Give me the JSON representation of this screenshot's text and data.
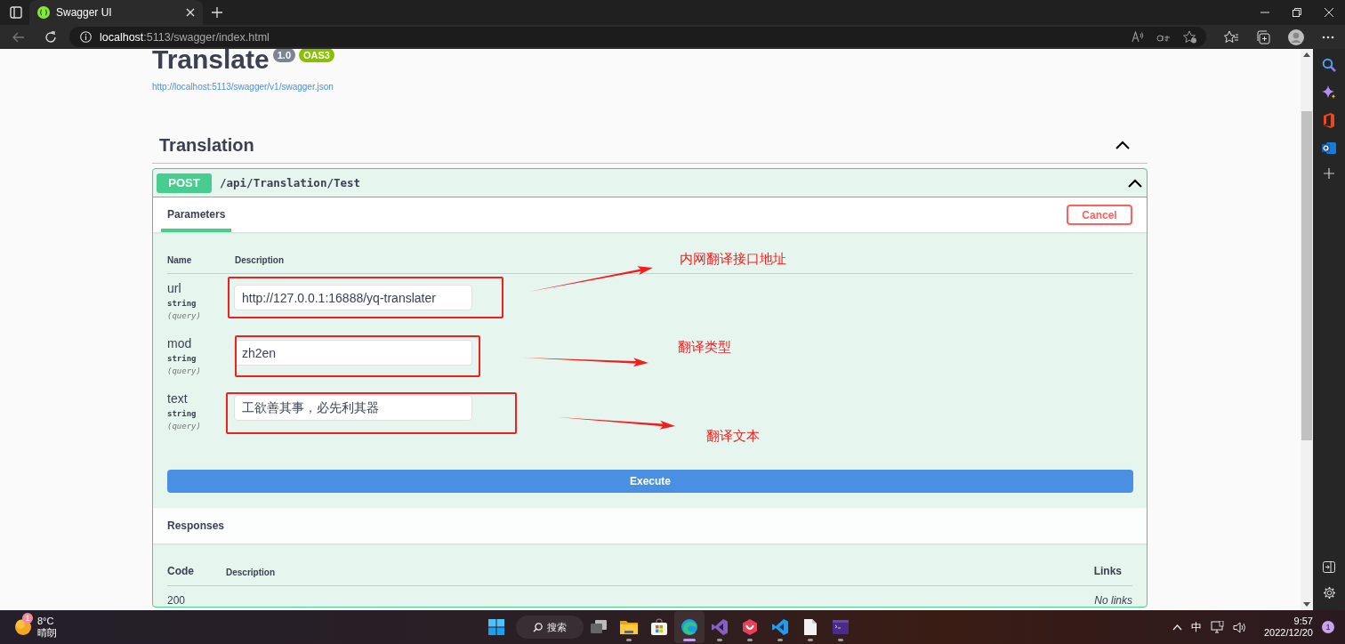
{
  "browser": {
    "tabs": [
      {
        "title": "Swagger UI",
        "selected": true
      }
    ],
    "address": "**localhost**:5113/swagger/index.html"
  },
  "api": {
    "title": "Translate",
    "version": "1.0",
    "spec_badge": "OAS3",
    "spec_url": "http://localhost:5113/swagger/v1/swagger.json"
  },
  "section": {
    "name": "Translation",
    "expanded": true
  },
  "operation": {
    "method": "POST",
    "path": "/api/Translation/Test",
    "expanded": true,
    "tabs": [
      {
        "label": "Parameters",
        "selected": true
      }
    ],
    "cancel_button": "Cancel",
    "parameter_columns": [
      "Name",
      "Description"
    ],
    "parameters": [
      {
        "name": "url",
        "type": "string",
        "location": "(query)",
        "value": "http://127.0.0.1:16888/yq-translater"
      },
      {
        "name": "mod",
        "type": "string",
        "location": "(query)",
        "value": "zh2en"
      },
      {
        "name": "text",
        "type": "string",
        "location": "(query)",
        "value": "工欲善其事，必先利其器"
      }
    ],
    "execute_button": "Execute",
    "responses": {
      "title": "Responses",
      "columns": [
        "Code",
        "Description",
        "Links"
      ],
      "rows": [
        {
          "code": "200",
          "links": "No links"
        }
      ]
    }
  },
  "annotations": [
    {
      "label": "内网翻译接口地址"
    },
    {
      "label": "翻译类型"
    },
    {
      "label": "翻译文本"
    }
  ],
  "taskbar": {
    "weather": {
      "badge": "1",
      "temperature": "8°C",
      "condition": "晴朗"
    },
    "search": "搜索",
    "apps": [
      {
        "running": false,
        "active": false
      },
      {
        "running": true,
        "active": false
      },
      {
        "running": false,
        "active": false
      },
      {
        "running": true,
        "active": true
      },
      {
        "running": true,
        "active": false
      },
      {
        "running": true,
        "active": false
      },
      {
        "running": true,
        "active": false
      },
      {
        "running": true,
        "active": false
      },
      {
        "running": true,
        "active": false
      }
    ],
    "ime": "中",
    "time": "9:57",
    "date": "2022/12/20",
    "notifications": "1"
  }
}
